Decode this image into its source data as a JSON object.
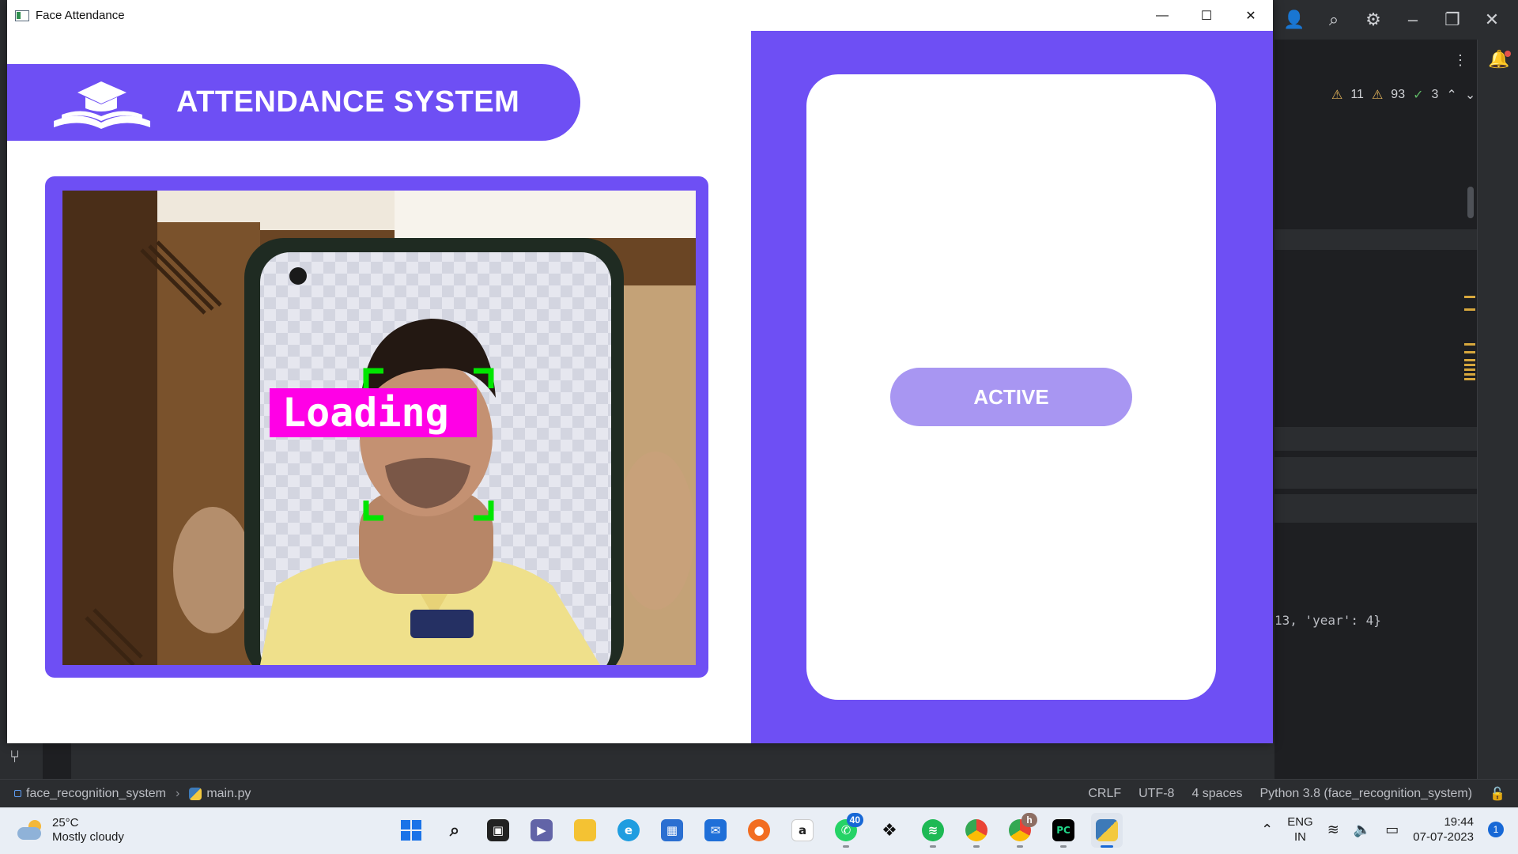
{
  "window": {
    "title": "Face Attendance",
    "controls": {
      "minimize": "—",
      "maximize": "☐",
      "close": "✕"
    }
  },
  "app": {
    "header_title": "ATTENDANCE SYSTEM",
    "overlay_label": "Loading",
    "status_button": "ACTIVE",
    "colors": {
      "accent": "#6e4ff4",
      "button": "#a896f2",
      "face_box": "#00e600",
      "overlay": "#ff00e6"
    }
  },
  "ide": {
    "inspections": {
      "warnings_a": "11",
      "warnings_b": "93",
      "ok": "3"
    },
    "code_fragment": "13, 'year': 4}",
    "breadcrumb": {
      "project": "face_recognition_system",
      "file": "main.py"
    },
    "status": {
      "line_ending": "CRLF",
      "encoding": "UTF-8",
      "indent": "4 spaces",
      "interpreter": "Python 3.8 (face_recognition_system)"
    }
  },
  "taskbar": {
    "weather": {
      "temp": "25°C",
      "desc": "Mostly cloudy"
    },
    "whatsapp_badge": "40",
    "chrome_badge": "h",
    "lang_top": "ENG",
    "lang_bottom": "IN",
    "time": "19:44",
    "date": "07-07-2023",
    "notification_count": "1"
  }
}
